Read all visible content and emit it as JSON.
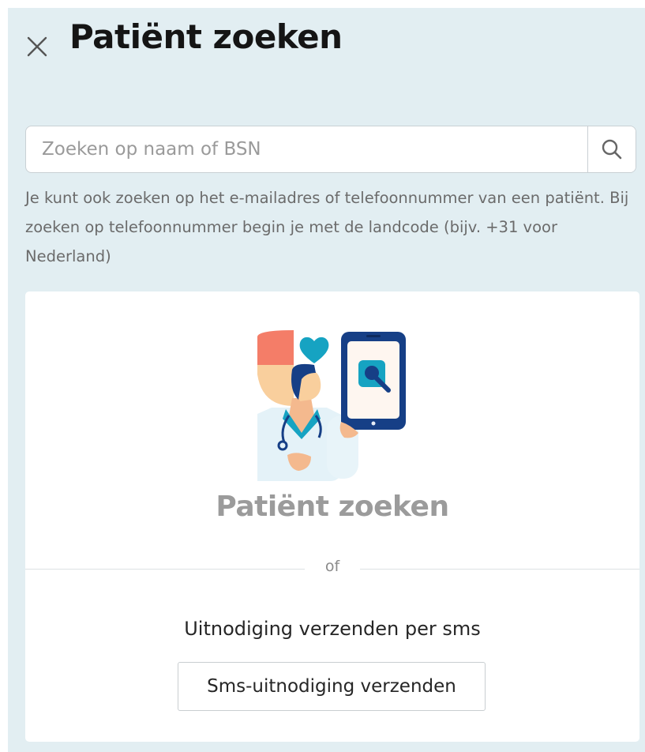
{
  "header": {
    "title": "Patiënt zoeken",
    "close_icon": "close-icon"
  },
  "search": {
    "placeholder": "Zoeken op naam of BSN",
    "value": "",
    "icon": "search-icon",
    "hint": "Je kunt ook zoeken op het e-mailadres of telefoonnummer van een patiënt. Bij zoeken op telefoonnummer begin je met de landcode (bijv. +31 voor Nederland)"
  },
  "card": {
    "illustration": "doctor-with-phone-illustration",
    "title": "Patiënt zoeken",
    "divider_text": "of",
    "sms_label": "Uitnodiging verzenden per sms",
    "sms_button": "Sms-uitnodiging verzenden"
  },
  "colors": {
    "panel_background": "#e2eef2",
    "illustration_navy": "#163f86",
    "illustration_teal": "#16a3c2",
    "illustration_coral": "#f47d68",
    "illustration_peach": "#f9cf9d"
  }
}
